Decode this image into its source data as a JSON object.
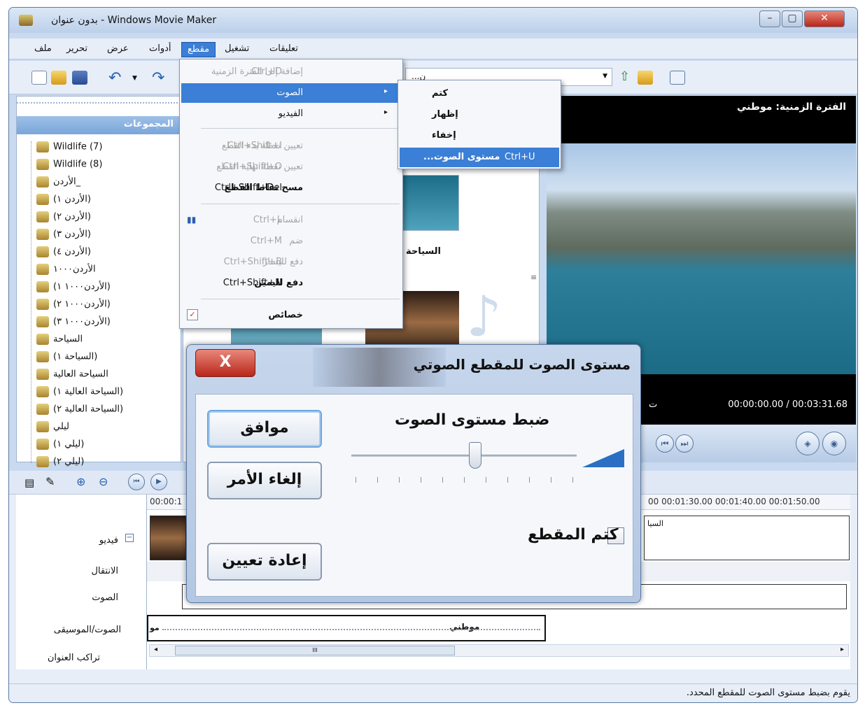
{
  "window": {
    "title": "بدون عنوان - Windows Movie Maker"
  },
  "menu": {
    "items": [
      "تعليقات",
      "تشغيل",
      "مقطع",
      "أدوات",
      "عرض",
      "تحرير",
      "ملف"
    ],
    "active": "مقطع"
  },
  "toolbar": {
    "collections_dropdown": "...ن"
  },
  "collections": {
    "header": "المجموعات",
    "items": [
      "Wildlife (7)",
      "Wildlife (8)",
      "الأردن_",
      "(الأردن ١)",
      "(الأردن ٢)",
      "(الأردن ٣)",
      "(الأردن ٤)",
      "الأردن١٠٠٠",
      "(الأردن١٠٠٠ ١)",
      "(الأردن١٠٠٠ ٢)",
      "(الأردن١٠٠٠ ٣)",
      "السياحة",
      "(السياحة ١)",
      "السياحة العالية",
      "(السياحة العالية ١)",
      "(السياحة العالية ٢)",
      "ليلي",
      "(ليلي ١)",
      "(ليلي ٢)"
    ]
  },
  "dropdown": {
    "items": [
      {
        "label": "إضافة إلى الفترة الزمنية",
        "shortcut": "Ctrl+D",
        "disabled": true
      },
      {
        "label": "الصوت",
        "shortcut": "",
        "submenu": true,
        "highlighted": true
      },
      {
        "label": "الفيديو",
        "shortcut": "",
        "submenu": true
      },
      {
        "label": "تعيين نقطة بدء القطع",
        "shortcut": "Ctrl+Shift+I",
        "disabled": true
      },
      {
        "label": "تعيين نقطة نهاية القطع",
        "shortcut": "Ctrl+Shift+O",
        "disabled": true
      },
      {
        "label": "مسح نقاط القطع",
        "shortcut": "Ctrl+Shift+Del"
      },
      {
        "label": "انقسام",
        "shortcut": "Ctrl+L",
        "disabled": true
      },
      {
        "label": "ضم",
        "shortcut": "Ctrl+M",
        "disabled": true
      },
      {
        "label": "دفع لليسار",
        "shortcut": "Ctrl+Shift+B",
        "disabled": true
      },
      {
        "label": "دفع لليمين",
        "shortcut": "Ctrl+Shift+N"
      },
      {
        "label": "خصائص",
        "shortcut": ""
      }
    ]
  },
  "submenu": {
    "items": [
      {
        "label": "كتم",
        "shortcut": ""
      },
      {
        "label": "إظهار",
        "shortcut": ""
      },
      {
        "label": "إخفاء",
        "shortcut": ""
      },
      {
        "label": "...مستوى الصوت",
        "shortcut": "Ctrl+U",
        "highlighted": true
      }
    ]
  },
  "content": {
    "clip_label": "السياحة"
  },
  "preview": {
    "title": "الفترة الزمنية: موطني",
    "timecode": "00:00:00.00 / 00:03:31.68",
    "timecode_left": "ت"
  },
  "timeline": {
    "ruler_left": "00:00:1",
    "ruler_right": "00  00:01:30.00  00:01:40.00  00:01:50.00",
    "labels": {
      "video": "فيديو",
      "transition": "الانتقال",
      "audio": "الصوت",
      "music": "الصوت/الموسيقى",
      "title_overlay": "تراكب العنوان"
    },
    "music_clip": "موطني",
    "music_clip_left": "مو",
    "video_clip_right": "السيا",
    "scroll_marker": "III"
  },
  "dialog": {
    "title": "مستوى الصوت للمقطع الصوتي",
    "close": "X",
    "slider_label": "ضبط مستوى الصوت",
    "slider_value": 0.55,
    "ok": "موافق",
    "cancel": "إلغاء الأمر",
    "reset": "إعادة تعيين",
    "mute_label": "كتم المقطع",
    "mute_checked": false
  },
  "status": {
    "text": ".يقوم بضبط مستوى الصوت للمقطع المحدد"
  },
  "colors": {
    "accent": "#3b7fd6",
    "close_red": "#b8261a"
  }
}
